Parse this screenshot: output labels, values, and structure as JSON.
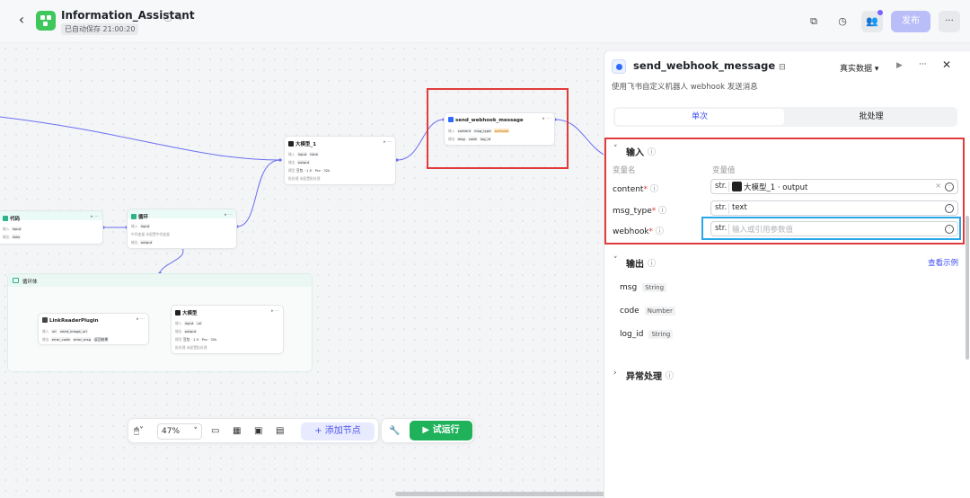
{
  "header": {
    "back_icon": "chevron-left-icon",
    "title": "Information_Assistant",
    "saved": "已自动保存 21:00:20",
    "publish": "发布",
    "more": "···"
  },
  "canvas": {
    "nodes": {
      "llm1": {
        "title": "大模型_1",
        "r1_label": "输入",
        "r1_tags": [
          "input",
          "time"
        ],
        "r2_label": "输出",
        "r2_tags": [
          "output"
        ],
        "r3_label": "模型",
        "r3_val": "豆包 · 1.5 · Pro · 32k",
        "r4_label": "批处理",
        "r4_val": "未配置批处理"
      },
      "webhook": {
        "title": "send_webhook_message",
        "r1_label": "输入",
        "r1_tags": [
          "content",
          "msg_type",
          "outhook"
        ],
        "r2_label": "输出",
        "r2_tags": [
          "msg",
          "code",
          "log_id"
        ]
      },
      "code": {
        "title": "代码",
        "r1_label": "输入",
        "r1_tag": "input",
        "r2_label": "输出",
        "r2_tag": "links"
      },
      "loop": {
        "title": "循环",
        "r1_label": "输入",
        "r1_tag": "input",
        "r2_label": "中间变量",
        "r2_val": "未配置中间变量",
        "r3_label": "输出",
        "r3_tag": "output"
      },
      "loopbody": {
        "title": "循环体"
      },
      "linkreader": {
        "title": "LinkReaderPlugin",
        "r1_label": "输入",
        "r1_tags": [
          "url",
          "need_image_url"
        ],
        "r2_label": "输出",
        "r2_tags": [
          "error_code",
          "error_msg",
          "返回结果"
        ]
      },
      "llm2": {
        "title": "大模型",
        "r1_label": "输入",
        "r1_tags": [
          "input",
          "url"
        ],
        "r2_label": "输出",
        "r2_tags": [
          "output"
        ],
        "r3_label": "模型",
        "r3_val": "豆包 · 1.5 · Pro · 32k",
        "r4_label": "批处理",
        "r4_val": "未配置批处理"
      }
    }
  },
  "bottombar": {
    "zoom": "47%",
    "add_node": "+ 添加节点",
    "run": "▶ 试运行"
  },
  "panel": {
    "title": "send_webhook_message",
    "description": "使用飞书自定义机器人 webhook 发送消息",
    "env": "真实数据 ▾",
    "tabs": [
      "单次",
      "批处理"
    ],
    "input_section": "输入",
    "col_name": "变量名",
    "col_value": "变量值",
    "inputs": [
      {
        "name": "content",
        "type": "str.",
        "value": "大模型_1 · output"
      },
      {
        "name": "msg_type",
        "type": "str.",
        "value": "text"
      },
      {
        "name": "webhook",
        "type": "str.",
        "placeholder": "输入或引用参数值"
      }
    ],
    "output_section": "输出",
    "view_example": "查看示例",
    "outputs": [
      {
        "name": "msg",
        "type": "String"
      },
      {
        "name": "code",
        "type": "Number"
      },
      {
        "name": "log_id",
        "type": "String"
      }
    ],
    "error_section": "异常处理"
  },
  "colors": {
    "accent": "#4e55e8",
    "run_green": "#1fb25a",
    "highlight_red": "#e23b3b",
    "highlight_blue": "#2aa6e8",
    "wire": "#6b6ff0"
  }
}
